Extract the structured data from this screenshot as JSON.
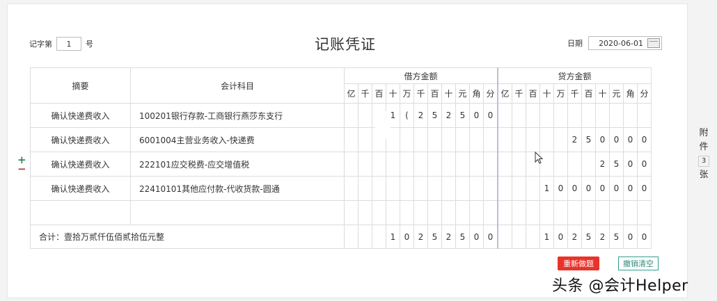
{
  "header": {
    "voucher_prefix": "记字第",
    "voucher_no": "1",
    "voucher_suffix": "号",
    "title": "记账凭证",
    "date_label": "日期",
    "date_value": "2020-06-01"
  },
  "table": {
    "col_summary": "摘要",
    "col_account": "会计科目",
    "debit_label": "借方金额",
    "credit_label": "贷方金额",
    "debit_units": [
      "亿",
      "千",
      "百",
      "十",
      "万",
      "千",
      "百",
      "十",
      "元",
      "角",
      "分"
    ],
    "credit_units": [
      "亿",
      "千",
      "百",
      "十",
      "万",
      "千",
      "百",
      "十",
      "元",
      "角",
      "分"
    ],
    "rows": [
      {
        "summary": "确认快递费收入",
        "account": "100201银行存款-工商银行燕莎东支行",
        "debit": [
          "",
          "",
          "",
          "1",
          "(",
          "2",
          "5",
          "2",
          "5",
          "0",
          "0"
        ],
        "credit": [
          "",
          "",
          "",
          "",
          "",
          "",
          "",
          "",
          "",
          "",
          ""
        ]
      },
      {
        "summary": "确认快递费收入",
        "account": "6001004主营业务收入-快递费",
        "debit": [
          "",
          "",
          "",
          "",
          "",
          "",
          "",
          "",
          "",
          "",
          ""
        ],
        "credit": [
          "",
          "",
          "",
          "",
          "",
          "2",
          "5",
          "0",
          "0",
          "0",
          "0"
        ]
      },
      {
        "summary": "确认快递费收入",
        "account": "222101应交税费-应交增值税",
        "debit": [
          "",
          "",
          "",
          "",
          "",
          "",
          "",
          "",
          "",
          "",
          ""
        ],
        "credit": [
          "",
          "",
          "",
          "",
          "",
          "",
          "",
          "2",
          "5",
          "0",
          "0"
        ]
      },
      {
        "summary": "确认快递费收入",
        "account": "22410101其他应付款-代收货款-圆通",
        "debit": [
          "",
          "",
          "",
          "",
          "",
          "",
          "",
          "",
          "",
          "",
          ""
        ],
        "credit": [
          "",
          "",
          "",
          "1",
          "0",
          "0",
          "0",
          "0",
          "0",
          "0",
          "0"
        ]
      },
      {
        "summary": "",
        "account": "",
        "debit": [
          "",
          "",
          "",
          "",
          "",
          "",
          "",
          "",
          "",
          "",
          ""
        ],
        "credit": [
          "",
          "",
          "",
          "",
          "",
          "",
          "",
          "",
          "",
          "",
          ""
        ]
      }
    ],
    "total_label": "合计：壹拾万贰仟伍佰贰拾伍元整",
    "total_debit": [
      "",
      "",
      "",
      "1",
      "0",
      "2",
      "5",
      "2",
      "5",
      "0",
      "0"
    ],
    "total_credit": [
      "",
      "",
      "",
      "1",
      "0",
      "2",
      "5",
      "2",
      "5",
      "0",
      "0"
    ]
  },
  "buttons": {
    "redo": "重新做题",
    "clear": "撤销清空"
  },
  "attachment": {
    "top": "附",
    "mid": "件",
    "count": "3",
    "bottom": "张"
  },
  "row_controls": {
    "add": "+",
    "remove": "−"
  },
  "watermark": "头条 @会计Helper",
  "colors": {
    "redo_bg": "#e8332a",
    "clear_border": "#2e9e8e",
    "add": "#2e8b57",
    "remove": "#c0392b"
  }
}
